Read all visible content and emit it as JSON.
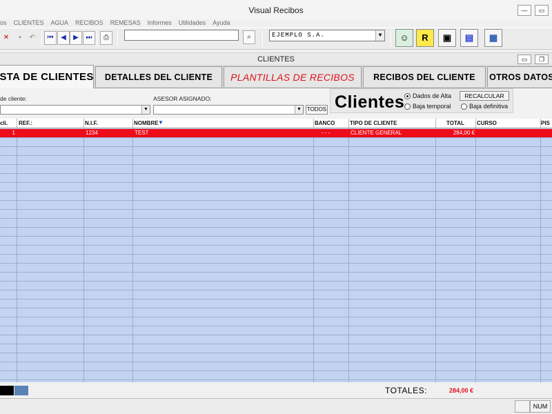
{
  "window": {
    "title": "Visual Recibos"
  },
  "menu": [
    "os",
    "CLIENTES",
    "AGUA",
    "RECIBOS",
    "REMESAS",
    "Informes",
    "Utilidades",
    "Ayuda"
  ],
  "toolbar": {
    "search_value": "",
    "company": "EJEMPLO S.A."
  },
  "toolbar_icons": [
    "exit-icon",
    "save-icon",
    "undo-icon",
    "first-record-icon",
    "previous-record-icon",
    "next-record-icon",
    "last-record-icon",
    "print-icon",
    "find-icon",
    "contact-icon",
    "receipt-icon",
    "disk-icon",
    "documents-icon",
    "calculator-icon"
  ],
  "subwindow": {
    "title": "CLIENTES"
  },
  "tabs": [
    "ISTA DE CLIENTES",
    "DETALLES DEL CLIENTE",
    "PLANTILLAS DE RECIBOS",
    "RECIBOS DEL CLIENTE",
    "OTROS DATOS"
  ],
  "filters": {
    "client_type_label": "de cliente:",
    "client_type_value": "",
    "advisor_label": "ASESOR ASIGNADO:",
    "advisor_value": "",
    "all_button": "TODOS"
  },
  "panel": {
    "heading": "Clientes",
    "radios": [
      {
        "label": "Dados de Alta",
        "checked": true
      },
      {
        "label": "Baja temporal",
        "checked": false
      },
      {
        "label": "Baja definitiva",
        "checked": false
      }
    ],
    "recalc_button": "RECALCULAR"
  },
  "table": {
    "columns": [
      "cli.",
      "REF.:",
      "N.I.F.",
      "NOMBRE",
      "BANCO",
      "TIPO DE CLIENTE",
      "TOTAL",
      "CURSO",
      "PIS"
    ],
    "rows": [
      {
        "cli": "1",
        "ref": "",
        "nif": "1234",
        "nombre": "TEST",
        "banco": "- - -",
        "tipo": "CLIENTE GENERAL",
        "total": "284,00 €",
        "curso": "",
        "pis": ""
      }
    ],
    "highlight_color": "#ee0b1a",
    "background_color": "#c2d4f2"
  },
  "footer": {
    "totals_label": "TOTALES:",
    "totals_value": "284,00 €"
  },
  "statusbar": {
    "num": "NUM"
  }
}
